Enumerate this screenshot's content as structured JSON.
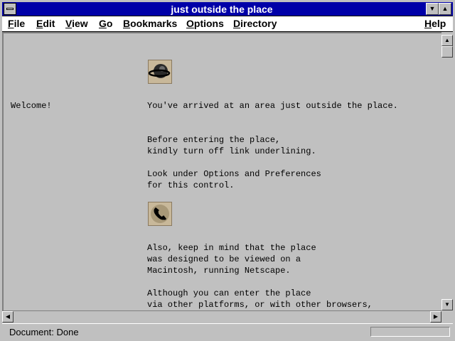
{
  "window": {
    "title": "just outside the place"
  },
  "menubar": {
    "items": [
      {
        "label": "File",
        "mnemonic": "F",
        "rest": "ile"
      },
      {
        "label": "Edit",
        "mnemonic": "E",
        "rest": "dit"
      },
      {
        "label": "View",
        "mnemonic": "V",
        "rest": "iew"
      },
      {
        "label": "Go",
        "mnemonic": "G",
        "rest": "o"
      },
      {
        "label": "Bookmarks",
        "mnemonic": "B",
        "rest": "ookmarks"
      },
      {
        "label": "Options",
        "mnemonic": "O",
        "rest": "ptions"
      },
      {
        "label": "Directory",
        "mnemonic": "D",
        "rest": "irectory"
      },
      {
        "label": "Help",
        "mnemonic": "H",
        "rest": "elp"
      }
    ]
  },
  "page": {
    "welcome": "Welcome!",
    "line1": "You've arrived at an area just outside the place.",
    "para2_l1": "Before entering the place,",
    "para2_l2": "kindly turn off link underlining.",
    "para3_l1": "Look under Options and Preferences",
    "para3_l2": "for this control.",
    "para4_l1": "Also, keep in mind that the place",
    "para4_l2": "was designed to be viewed on a",
    "para4_l3": "Macintosh, running Netscape.",
    "para5_l1": "Although you can enter the place",
    "para5_l2": "via other platforms, or with other browsers,",
    "icon1": "planet-icon",
    "icon2": "phone-icon"
  },
  "status": {
    "text": "Document: Done",
    "progress": 0
  },
  "colors": {
    "titlebar": "#0000a8",
    "background": "#c0c0c0"
  }
}
